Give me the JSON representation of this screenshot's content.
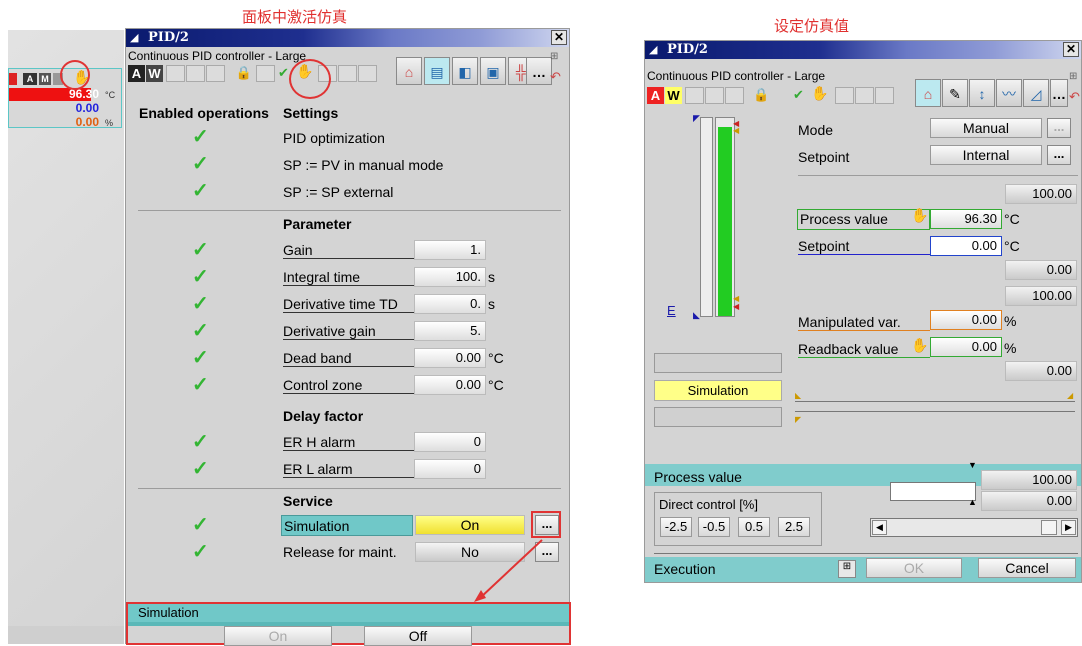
{
  "captions": {
    "left": "面板中激活仿真",
    "right": "设定仿真值"
  },
  "faceplate": {
    "buttons": [
      "A",
      "M"
    ],
    "pv": "96.30",
    "pv_unit": "°C",
    "sp": "0.00",
    "mv": "0.00",
    "mv_unit": "%"
  },
  "panel1": {
    "title": "PID/2",
    "subtitle": "Continuous PID controller - Large",
    "aw": [
      "A",
      "W"
    ],
    "col_enabled": "Enabled operations",
    "col_settings": "Settings",
    "settings": [
      {
        "label": "PID optimization"
      },
      {
        "label": "SP := PV in manual mode"
      },
      {
        "label": "SP := SP external"
      }
    ],
    "parameter_hdr": "Parameter",
    "parameters": [
      {
        "label": "Gain",
        "value": "1.",
        "unit": ""
      },
      {
        "label": "Integral time",
        "value": "100.",
        "unit": "s"
      },
      {
        "label": "Derivative time TD",
        "value": "0.",
        "unit": "s"
      },
      {
        "label": "Derivative gain",
        "value": "5.",
        "unit": ""
      },
      {
        "label": "Dead band",
        "value": "0.00",
        "unit": "°C"
      },
      {
        "label": "Control zone",
        "value": "0.00",
        "unit": "°C"
      }
    ],
    "delay_hdr": "Delay factor",
    "delays": [
      {
        "label": "ER H alarm",
        "value": "0"
      },
      {
        "label": "ER L alarm",
        "value": "0"
      }
    ],
    "service_hdr": "Service",
    "services": [
      {
        "label": "Simulation",
        "value": "On"
      },
      {
        "label": "Release for maint.",
        "value": "No"
      }
    ],
    "dots": "...",
    "footer_title": "Simulation",
    "on_label": "On",
    "off_label": "Off"
  },
  "panel2": {
    "title": "PID/2",
    "subtitle": "Continuous PID controller - Large",
    "aw": [
      "A",
      "W"
    ],
    "mode_label": "Mode",
    "mode_value": "Manual",
    "setpoint_label": "Setpoint",
    "setpoint_value": "Internal",
    "dots": "...",
    "hi_limit": "100.00",
    "pv_label": "Process value",
    "pv_value": "96.30",
    "pv_unit": "°C",
    "sp_label": "Setpoint",
    "sp_value": "0.00",
    "sp_unit": "°C",
    "sp_low": "0.00",
    "mv_hi": "100.00",
    "mv_label": "Manipulated var.",
    "mv_value": "0.00",
    "mv_unit": "%",
    "rb_label": "Readback value",
    "rb_value": "0.00",
    "rb_unit": "%",
    "rb_low": "0.00",
    "e_label": "E",
    "sim_label": "Simulation",
    "bottom_pv_label": "Process value",
    "bottom_hi": "100.00",
    "bottom_val": "0.00",
    "direct_label": "Direct control [%]",
    "steps": [
      "-2.5",
      "-0.5",
      "0.5",
      "2.5"
    ],
    "exec_label": "Execution",
    "ok_label": "OK",
    "cancel_label": "Cancel",
    "bar_fill": 0.963
  },
  "colors": {
    "accent": "#e03333",
    "teal": "#70c8c8",
    "sim_yellow": "#ffff66",
    "alarm_red": "#ee1111"
  }
}
